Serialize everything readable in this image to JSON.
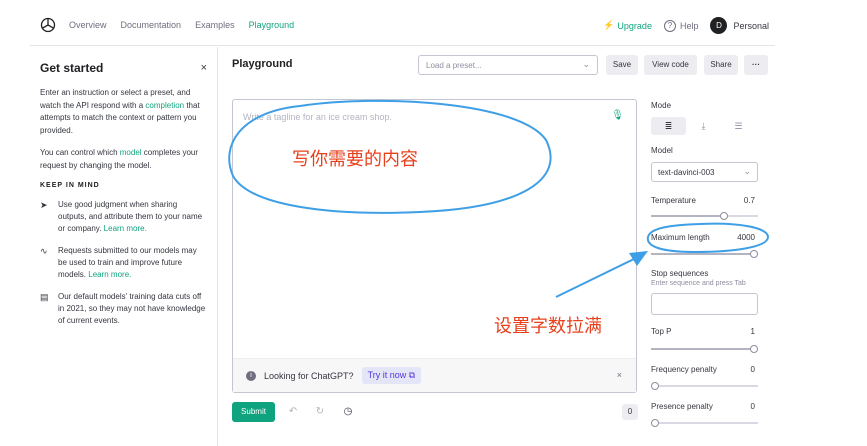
{
  "nav": {
    "links": [
      "Overview",
      "Documentation",
      "Examples",
      "Playground"
    ],
    "active": "Playground",
    "upgrade": "Upgrade",
    "help": "Help",
    "avatar_initial": "D",
    "account": "Personal"
  },
  "left": {
    "title": "Get started",
    "close": "×",
    "intro_1": "Enter an instruction or select a preset, and watch the API respond with a",
    "intro_link": "completion",
    "intro_2": "that attempts to match the context or pattern you provided.",
    "control_1": "You can control which",
    "control_link": "model",
    "control_2": "completes your request by changing the model.",
    "keep": "KEEP IN MIND",
    "tips": [
      {
        "icon": "send-icon",
        "text": "Use good judgment when sharing outputs, and attribute them to your name or company.",
        "link": "Learn more."
      },
      {
        "icon": "pulse-icon",
        "text": "Requests submitted to our models may be used to train and improve future models.",
        "link": "Learn more."
      },
      {
        "icon": "calendar-icon",
        "text": "Our default models' training data cuts off in 2021, so they may not have knowledge of current events.",
        "link": ""
      }
    ]
  },
  "center": {
    "title": "Playground",
    "preset_placeholder": "Load a preset...",
    "save": "Save",
    "view_code": "View code",
    "share": "Share",
    "more": "···",
    "editor_placeholder": "Write a tagline for an ice cream shop.",
    "chat_text": "Looking for ChatGPT?",
    "try_it": "Try it now",
    "chat_close": "×",
    "submit": "Submit",
    "token_count": "0"
  },
  "settings": {
    "mode_label": "Mode",
    "model_label": "Model",
    "model_value": "text-davinci-003",
    "temperature_label": "Temperature",
    "temperature_value": "0.7",
    "temperature_fraction": 0.7,
    "maxlen_label": "Maximum length",
    "maxlen_value": "4000",
    "maxlen_fraction": 1.0,
    "stop_label": "Stop sequences",
    "stop_help": "Enter sequence and press Tab",
    "topp_label": "Top P",
    "topp_value": "1",
    "topp_fraction": 1.0,
    "freq_label": "Frequency penalty",
    "freq_value": "0",
    "freq_fraction": 0,
    "pres_label": "Presence penalty",
    "pres_value": "0",
    "pres_fraction": 0
  },
  "annotations": {
    "write_here": "写你需要的内容",
    "set_max": "设置字数拉满",
    "color": "#e8401c",
    "circle_color": "#3f9fe6"
  }
}
